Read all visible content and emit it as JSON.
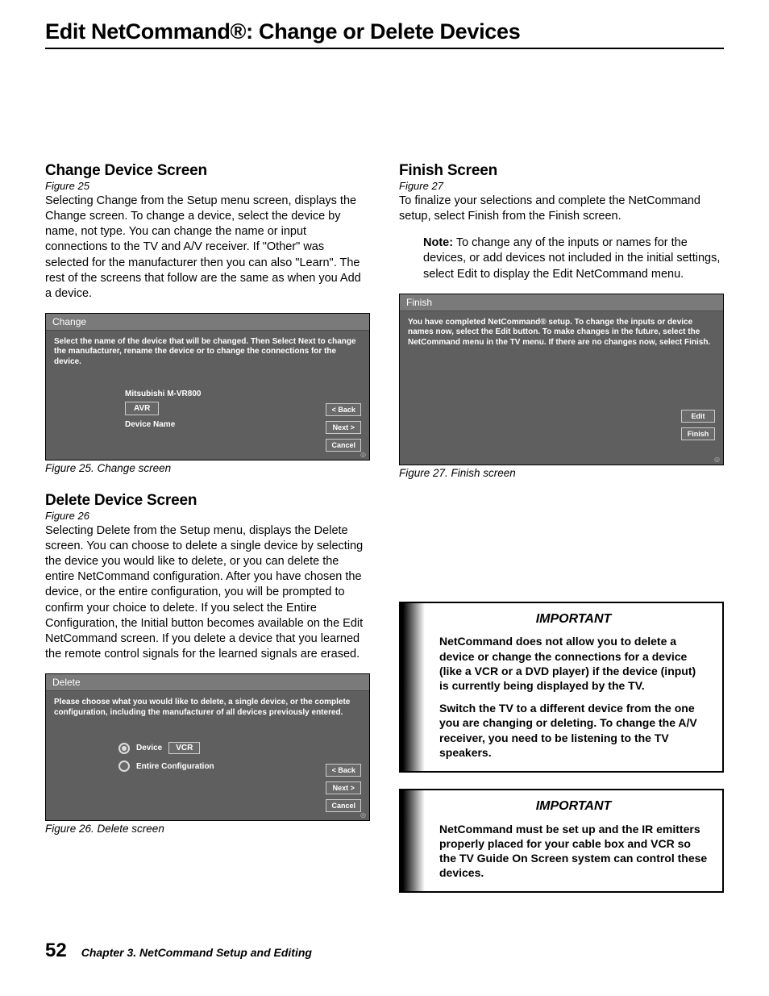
{
  "page_title": "Edit NetCommand®:  Change or Delete Devices",
  "left": {
    "sec1": {
      "heading": "Change Device Screen",
      "figref": "Figure 25",
      "body": "Selecting Change from the Setup menu screen, displays the Change screen. To change a device, select the device by name, not type.  You can change the name or input connections to the TV and A/V receiver.  If \"Other\" was selected for the manufacturer then you can also \"Learn\".  The rest of the screens that follow are the same as when you Add a device.",
      "shot": {
        "title": "Change",
        "instr": "Select the name of the device that will be changed.  Then Select Next to change the manufacturer, rename the device or to change the connections for the device.",
        "device": "Mitsubishi M-VR800",
        "input_val": "AVR",
        "input_label": "Device Name",
        "buttons": [
          "< Back",
          "Next >",
          "Cancel"
        ]
      },
      "caption": "Figure 25. Change screen"
    },
    "sec2": {
      "heading": "Delete Device Screen",
      "figref": "Figure 26",
      "body": "Selecting Delete from the Setup menu, displays the Delete screen.  You can choose to delete a single device by selecting the device you would like to delete, or you can delete the entire NetCommand configuration.  After you have chosen the device, or the entire configuration, you will be prompted to confirm your choice to delete.  If you select the Entire Configuration, the Initial button becomes available on the Edit NetCommand screen.  If you delete a device that you learned the remote control signals for the learned signals are erased.",
      "shot": {
        "title": "Delete",
        "instr": "Please choose what you would like to delete, a single device, or the complete configuration, including the manufacturer of all devices previously entered.",
        "opt1_label": "Device",
        "opt1_val": "VCR",
        "opt2_label": "Entire Configuration",
        "buttons": [
          "< Back",
          "Next >",
          "Cancel"
        ]
      },
      "caption": "Figure 26. Delete screen"
    }
  },
  "right": {
    "sec1": {
      "heading": "Finish Screen",
      "figref": "Figure 27",
      "body": "To finalize your selections and complete the NetCommand setup, select Finish from the Finish screen.",
      "note_label": "Note:",
      "note_body": "  To change any of the inputs or names for the devices, or add devices not included in the initial settings, select Edit to display the Edit NetCommand menu.",
      "shot": {
        "title": "Finish",
        "instr": "You have completed NetCommand® setup.  To change the inputs or device names now, select the Edit button.  To make changes in the future, select the NetCommand menu in the TV menu.  If there are no changes now, select Finish.",
        "buttons": [
          "Edit",
          "Finish"
        ]
      },
      "caption": "Figure 27. Finish screen"
    },
    "important1": {
      "title": "IMPORTANT",
      "p1": "NetCommand does not allow you to delete a device or change the connections for a device (like a VCR or a DVD player) if the device (input) is currently being displayed by the TV.",
      "p2": "Switch the TV to a different device from the one you are changing or deleting.  To change the A/V receiver, you need to be listening to the TV speakers."
    },
    "important2": {
      "title": "IMPORTANT",
      "p1": "NetCommand must be set up and the IR emitters properly placed for your cable box and VCR so the TV Guide On Screen system can control these devices."
    }
  },
  "footer": {
    "page": "52",
    "chapter": "Chapter 3. NetCommand Setup and Editing"
  }
}
